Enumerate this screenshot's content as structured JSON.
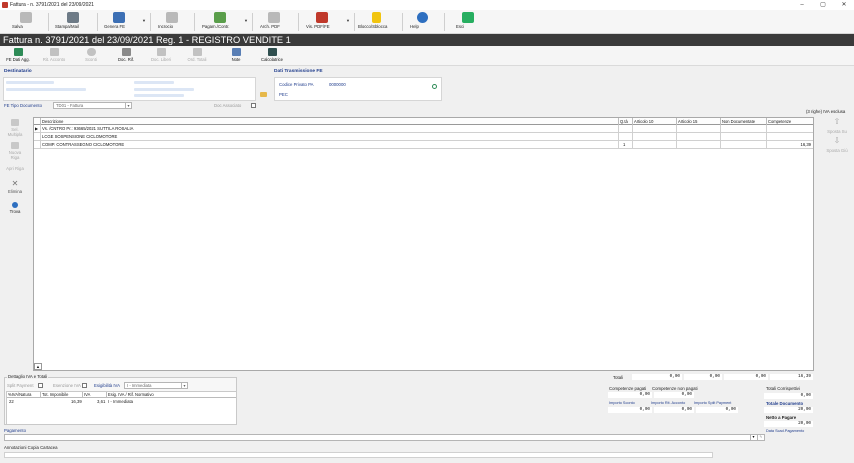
{
  "window": {
    "title": "Fattura - n. 3791/2021 del 23/09/2021",
    "min": "–",
    "max": "▢",
    "close": "✕"
  },
  "toolbar": {
    "salva": "Salva",
    "stampa": "Stampa/Mail",
    "genera_fe": "Genera FE",
    "incrocio": "Incrocio",
    "pagam": "Pagam./Contr.",
    "arch_pdf": "Arch. PDF",
    "vis_pdf": "Vis. PDF/FE",
    "blocco": "Blocco/Sblocca",
    "help": "Help",
    "esci": "Esci"
  },
  "header": {
    "title": "Fattura n. 3791/2021 del 23/09/2021 Reg. 1 - REGISTRO VENDITE 1"
  },
  "subtoolbar": {
    "fe_dati": "FE Dati Agg.",
    "rit_acconto": "Rit. Acconto",
    "sconti": "Sconti",
    "doc_rif": "Doc. Rif.",
    "doc_liberi": "Doc. Liberi",
    "ord_totali": "Ord. Totali",
    "note": "Note",
    "calcolatrice": "Calcolatrice"
  },
  "destinatario": {
    "title": "Destinatario"
  },
  "trasmissione": {
    "title": "Dati Trasmissione FE",
    "codice_label": "Codice Privato PA",
    "codice_value": "0000000",
    "pec_label": "PEC"
  },
  "fe_tipo": {
    "label": "FE Tipo Documento",
    "value": "TD01 - Fattura",
    "doc_associato": "Doc Associato",
    "righe_info": "(3 righe) IVA esclusa"
  },
  "grid": {
    "columns": [
      "Descrizione",
      "Q.tà",
      "Articolo 10",
      "Articolo 15",
      "Non Documentate",
      "Competenze"
    ],
    "rows": [
      {
        "desc": "Vs. /CNTRO Pr.: 93665/2021 SUTTILA ROSALIA",
        "qty": "",
        "a10": "",
        "a15": "",
        "nondoc": "",
        "comp": ""
      },
      {
        "desc": "LCGE SOSPENSIONE CICLOMOTORE",
        "qty": "",
        "a10": "",
        "a15": "",
        "nondoc": "",
        "comp": ""
      },
      {
        "desc": "COMP. CONTRASSEGNO CICLOMOTORE",
        "qty": "1",
        "a10": "",
        "a15": "",
        "nondoc": "",
        "comp": "16,39"
      }
    ]
  },
  "sidebar_left": {
    "sel_multipla": "Sel. Multipla",
    "nuova_riga": "Nuova Riga",
    "apri_riga": "Apri Riga",
    "elimina": "Elimina",
    "trova": "Trova"
  },
  "sidebar_right": {
    "sposta_su": "Sposta Su",
    "sposta_giu": "Sposta Giù"
  },
  "iva_panel": {
    "title": "Dettaglio IVA e Totali",
    "split_payment": "Split Payment",
    "esenzione": "Esenzione IVA",
    "esigibilita": "Esigibilità IVA",
    "esig_value": "I - Immediata",
    "columns": [
      "%IVA/Natura",
      "Tot. Imponibile",
      "IVA",
      "Esig. IVA / Rif. Normativo"
    ],
    "row": {
      "aliquota": "22",
      "imponibile": "16,39",
      "iva": "3,61",
      "esig": "I - Immediata"
    }
  },
  "totals": {
    "totali_label": "Totali",
    "totali_values": [
      "0,00",
      "0,00",
      "0,00",
      "16,39"
    ],
    "comp_pagati": "Competenze pagati",
    "comp_non_pagati": "Competenze non pagati",
    "comp_pagati_val": "0,00",
    "comp_non_pagati_val": "0,00",
    "imp_sconto": "Importo Sconto",
    "imp_rit": "Importo Rit. Acconto",
    "imp_split": "Importo Split Payment",
    "imp_sconto_val": "0,00",
    "imp_rit_val": "0,00",
    "imp_split_val": "0,00",
    "tot_corrispettivi": "Totali Corrispettivi",
    "tot_corrispettivi_val": "0,00",
    "tot_documento": "Totale Documento",
    "tot_documento_val": "20,00",
    "netto": "Netto a Pagare",
    "netto_val": "20,00",
    "data_scad": "Data Scad.Pagamento"
  },
  "pagamento": {
    "label": "Pagamento"
  },
  "status": {
    "annotazioni": "Annotazioni Copia Cartacea"
  }
}
